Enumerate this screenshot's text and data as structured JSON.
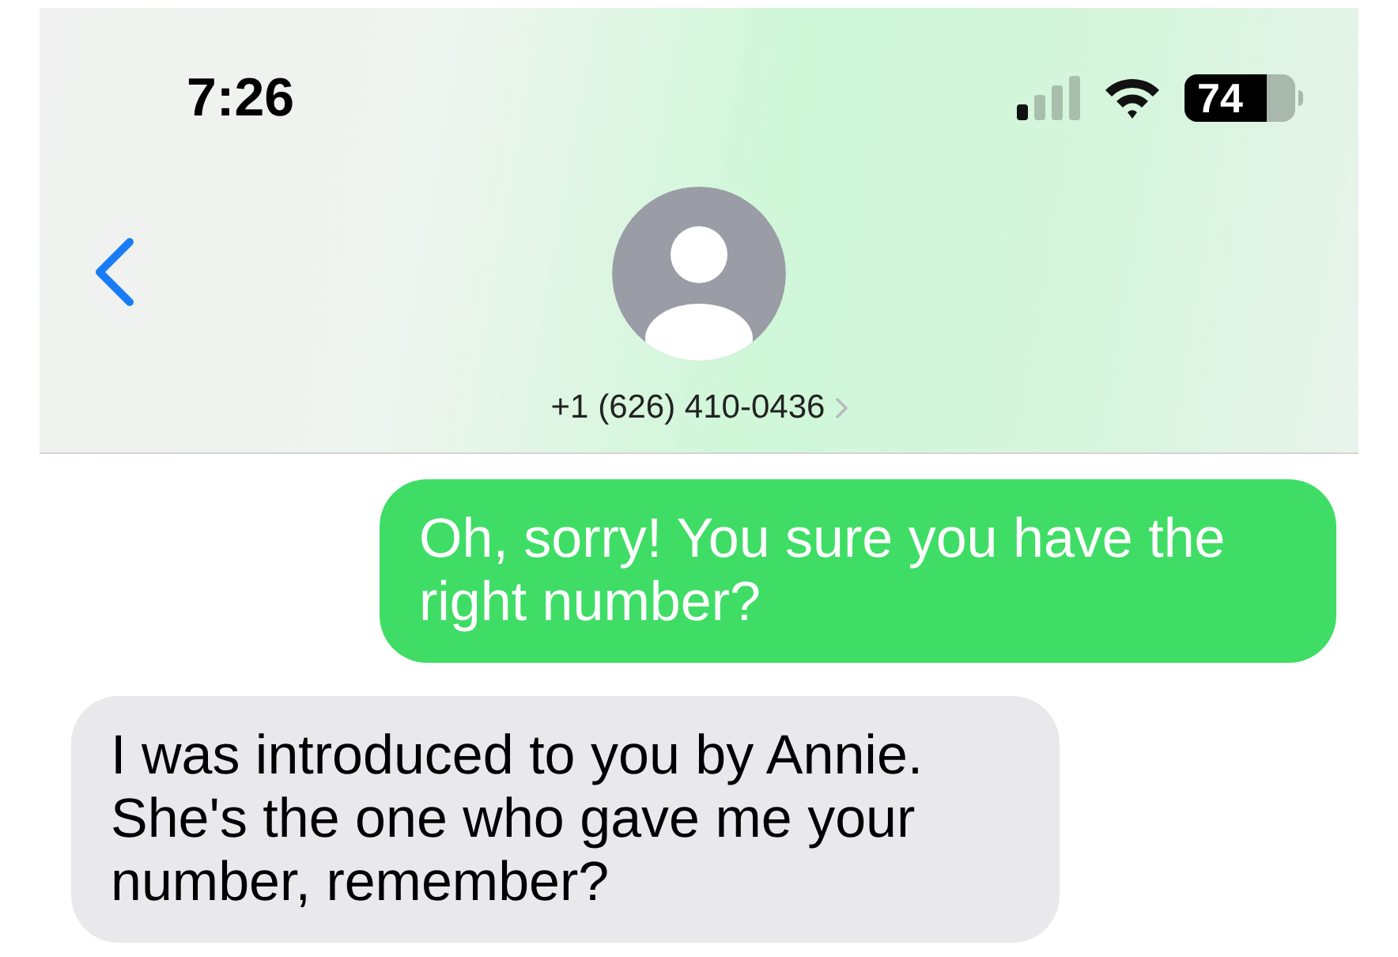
{
  "status_bar": {
    "time": "7:26",
    "battery": "74"
  },
  "header": {
    "contact": "+1 (626) 410-0436"
  },
  "messages": [
    {
      "kind": "outgoing",
      "text": "Oh, sorry! You sure you have the right number?"
    },
    {
      "kind": "incoming",
      "text": "I was introduced to you by Annie. She's the one who gave me your number, remember?"
    }
  ]
}
